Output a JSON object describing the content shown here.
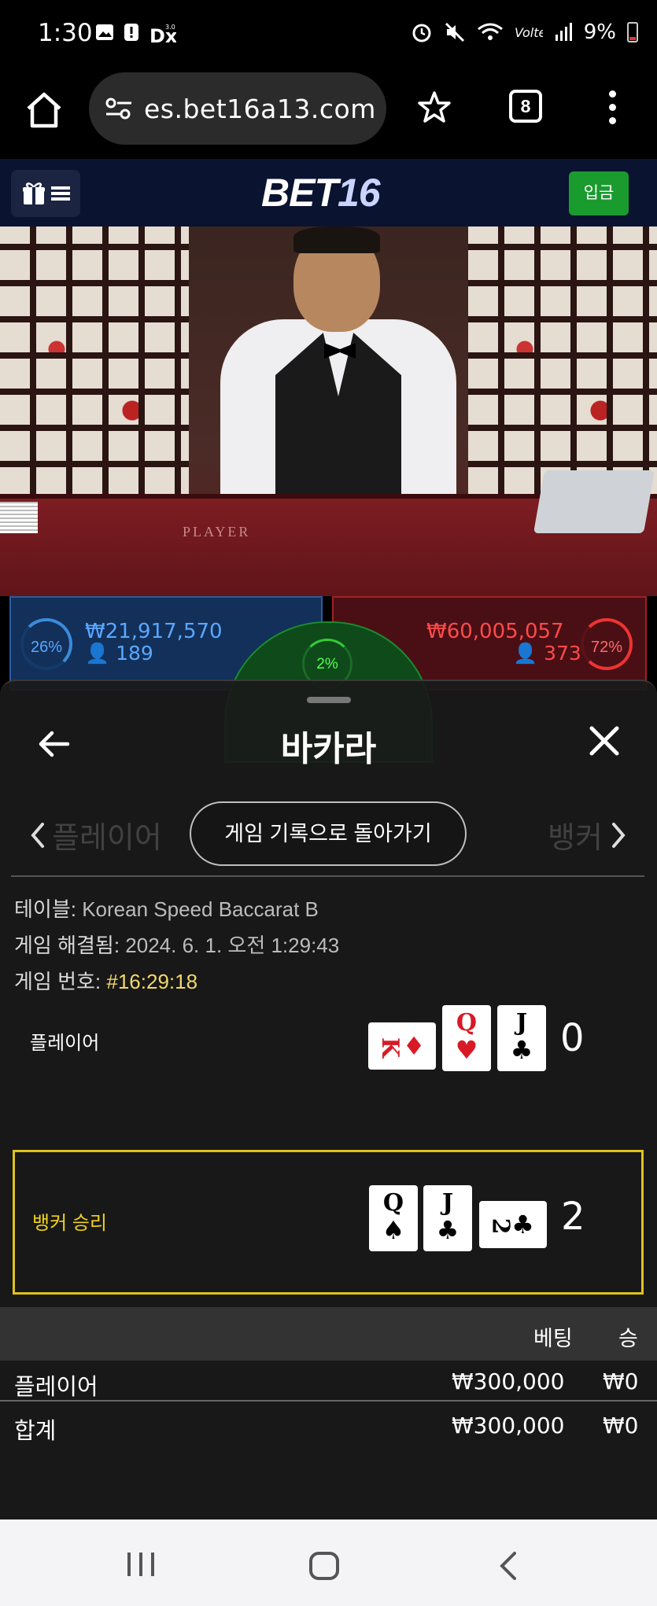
{
  "status_bar": {
    "time": "1:30",
    "battery": "9%",
    "icons": [
      "gallery-icon",
      "alert-icon",
      "dx-icon",
      "alarm-icon",
      "mute-icon",
      "wifi-icon",
      "volte-icon",
      "signal-icon",
      "battery-icon"
    ]
  },
  "browser": {
    "url": "es.bet16a13.com",
    "tab_count": "8"
  },
  "site_header": {
    "logo_main": "BET",
    "logo_num": "16",
    "deposit_label": "입금",
    "colors": {
      "header_bg": "#0a1330",
      "deposit_bg": "#1a9b2e"
    }
  },
  "video": {
    "table_text": "PLAYER"
  },
  "bet_panels": {
    "player_percent": "26%",
    "player_amount": "₩21,917,570",
    "player_count": "👤 189",
    "tie_percent": "2%",
    "banker_amount": "₩60,005,057",
    "banker_count": "👤 373",
    "banker_percent": "72%"
  },
  "modal": {
    "title": "바카라",
    "back_to_history": "게임 기록으로 돌아가기",
    "ghost_left": "플레이어",
    "ghost_right": "뱅커",
    "table_label": "테이블:",
    "table_value": "Korean Speed Baccarat B",
    "resolved_label": "게임 해결됨:",
    "resolved_value": "2024. 6. 1. 오전 1:29:43",
    "game_no_label": "게임 번호:",
    "game_no_value": "#16:29:18",
    "player_row": {
      "label": "플레이어",
      "cards": [
        {
          "rank": "K",
          "suit": "♦",
          "color": "red",
          "orientation": "horizontal"
        },
        {
          "rank": "Q",
          "suit": "♥",
          "color": "red",
          "orientation": "vertical"
        },
        {
          "rank": "J",
          "suit": "♣",
          "color": "black",
          "orientation": "vertical"
        }
      ],
      "score": "0"
    },
    "banker_row": {
      "label": "뱅커 승리",
      "cards": [
        {
          "rank": "Q",
          "suit": "♠",
          "color": "black",
          "orientation": "vertical"
        },
        {
          "rank": "J",
          "suit": "♣",
          "color": "black",
          "orientation": "vertical"
        },
        {
          "rank": "2",
          "suit": "♣",
          "color": "black",
          "orientation": "horizontal"
        }
      ],
      "score": "2",
      "highlight_color": "#e0c21a"
    },
    "table_headers": {
      "bet": "베팅",
      "win": "승"
    },
    "bet_rows": [
      {
        "name": "플레이어",
        "bet": "₩300,000",
        "win": "₩0"
      }
    ],
    "total_row": {
      "name": "합계",
      "bet": "₩300,000",
      "win": "₩0"
    }
  }
}
